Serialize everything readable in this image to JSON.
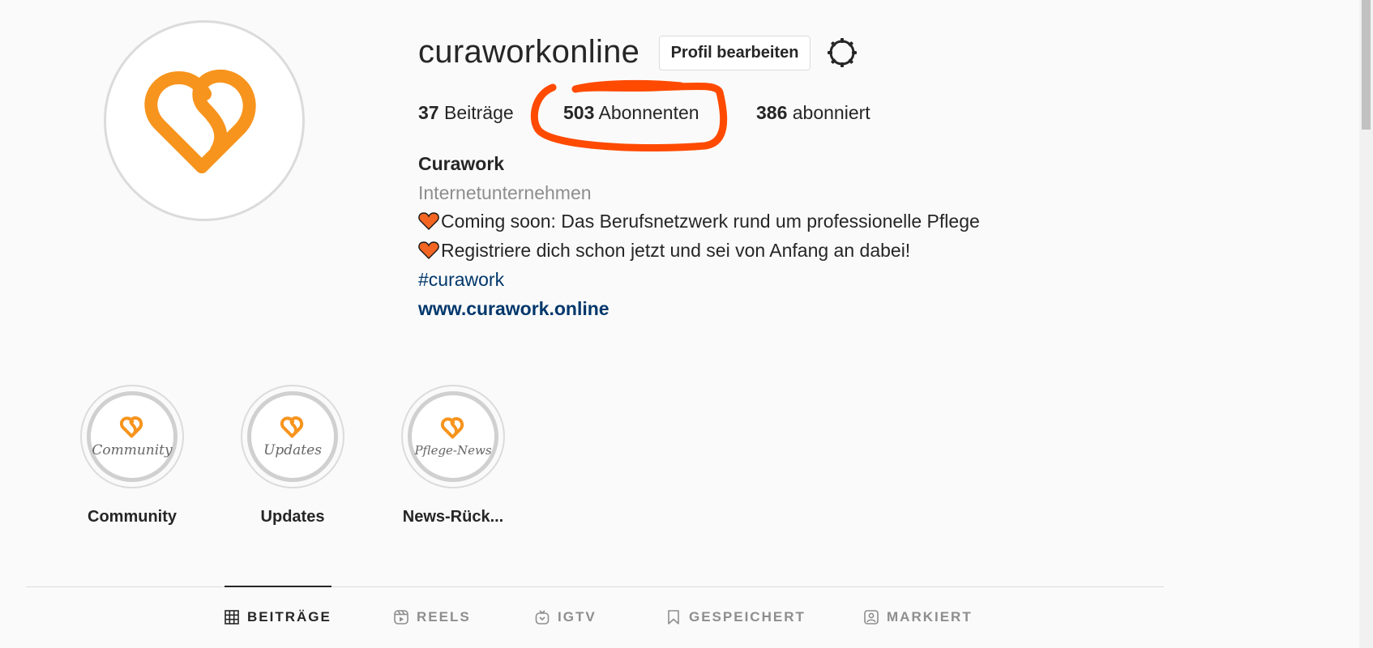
{
  "profile": {
    "username": "curaworkonline",
    "edit_button_label": "Profil bearbeiten"
  },
  "stats": {
    "posts_count": "37",
    "posts_label": "Beiträge",
    "followers_count": "503",
    "followers_label": "Abonnenten",
    "following_count": "386",
    "following_label": "abonniert"
  },
  "bio": {
    "name": "Curawork",
    "category": "Internetunternehmen",
    "line1": "Coming soon: Das Berufsnetzwerk rund um professionelle Pflege",
    "line2": "Registriere dich schon jetzt und sei von Anfang an dabei!",
    "hashtag": "#curawork",
    "website": "www.curawork.online"
  },
  "highlights": [
    {
      "script": "Community",
      "label": "Community"
    },
    {
      "script": "Updates",
      "label": "Updates"
    },
    {
      "script": "Pflege-News",
      "label": "News-Rück..."
    }
  ],
  "tabs": [
    {
      "label": "BEITRÄGE",
      "icon": "grid-icon",
      "active": true
    },
    {
      "label": "REELS",
      "icon": "reels-icon",
      "active": false
    },
    {
      "label": "IGTV",
      "icon": "igtv-icon",
      "active": false
    },
    {
      "label": "GESPEICHERT",
      "icon": "bookmark-icon",
      "active": false
    },
    {
      "label": "MARKIERT",
      "icon": "tagged-icon",
      "active": false
    }
  ],
  "colors": {
    "brand_orange": "#f7941d",
    "highlight_annotation": "#ff4a00",
    "link_blue": "#00376b",
    "heart_emoji": "#f26522"
  }
}
